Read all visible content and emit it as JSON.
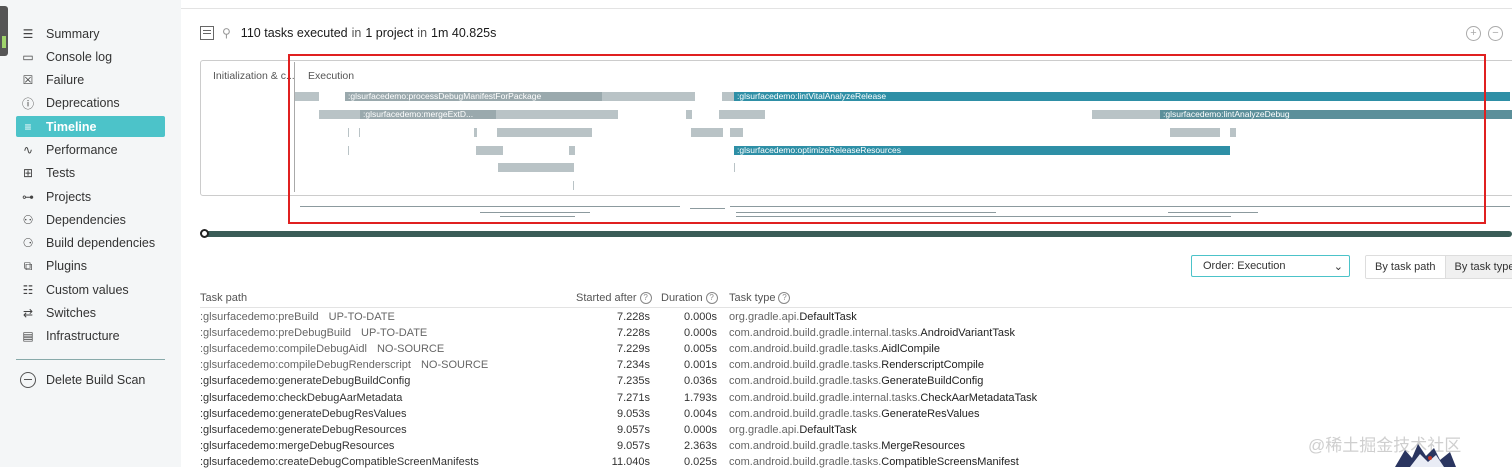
{
  "sidebar": {
    "items": [
      {
        "label": "Summary",
        "icon": "summary-icon",
        "glyph": "☰"
      },
      {
        "label": "Console log",
        "icon": "console-icon",
        "glyph": "▭"
      },
      {
        "label": "Failure",
        "icon": "failure-icon",
        "glyph": "☒"
      },
      {
        "label": "Deprecations",
        "icon": "deprecations-icon",
        "glyph": "ⓘ"
      },
      {
        "label": "Timeline",
        "icon": "timeline-icon",
        "glyph": "≡",
        "active": true
      },
      {
        "label": "Performance",
        "icon": "performance-icon",
        "glyph": "∿"
      },
      {
        "label": "Tests",
        "icon": "tests-icon",
        "glyph": "⊞"
      },
      {
        "label": "Projects",
        "icon": "projects-icon",
        "glyph": "⊶"
      },
      {
        "label": "Dependencies",
        "icon": "dependencies-icon",
        "glyph": "⚇"
      },
      {
        "label": "Build dependencies",
        "icon": "build-dependencies-icon",
        "glyph": "⚆"
      },
      {
        "label": "Plugins",
        "icon": "plugins-icon",
        "glyph": "⧉"
      },
      {
        "label": "Custom values",
        "icon": "custom-values-icon",
        "glyph": "☷"
      },
      {
        "label": "Switches",
        "icon": "switches-icon",
        "glyph": "⇄"
      },
      {
        "label": "Infrastructure",
        "icon": "infrastructure-icon",
        "glyph": "▤"
      }
    ],
    "delete_label": "Delete Build Scan"
  },
  "summary": {
    "count": "110",
    "text1": "tasks executed",
    "in1": "in",
    "projects": "1 project",
    "in2": "in",
    "duration": "1m 40.825s"
  },
  "timeline": {
    "init_label": "Initialization & c...",
    "exec_label": "Execution",
    "bar_labels": [
      ":glsurfacedemo:processDebugManifestForPackage",
      ":glsurfacedemo:lintVitalAnalyzeRelease",
      ":glsurfacedemo:mergeExtD...",
      ":glsurfacedemo:lintAnalyzeDebug",
      ":glsurfacedemo:optimizeReleaseResources"
    ]
  },
  "controls": {
    "order_label": "Order: Execution",
    "by_task_path": "By task path",
    "by_task_type": "By task type"
  },
  "table": {
    "headers": {
      "path": "Task path",
      "started": "Started after",
      "duration": "Duration",
      "type": "Task type"
    },
    "rows": [
      {
        "path": ":glsurfacedemo:preBuild",
        "outcome": "UP-TO-DATE",
        "started": "7.228s",
        "duration": "0.000s",
        "type_pkg": "org.gradle.api.",
        "type_cls": "DefaultTask"
      },
      {
        "path": ":glsurfacedemo:preDebugBuild",
        "outcome": "UP-TO-DATE",
        "started": "7.228s",
        "duration": "0.000s",
        "type_pkg": "com.android.build.gradle.internal.tasks.",
        "type_cls": "AndroidVariantTask"
      },
      {
        "path": ":glsurfacedemo:compileDebugAidl",
        "outcome": "NO-SOURCE",
        "started": "7.229s",
        "duration": "0.005s",
        "type_pkg": "com.android.build.gradle.tasks.",
        "type_cls": "AidlCompile"
      },
      {
        "path": ":glsurfacedemo:compileDebugRenderscript",
        "outcome": "NO-SOURCE",
        "started": "7.234s",
        "duration": "0.001s",
        "type_pkg": "com.android.build.gradle.tasks.",
        "type_cls": "RenderscriptCompile"
      },
      {
        "path": ":glsurfacedemo:generateDebugBuildConfig",
        "outcome": "",
        "started": "7.235s",
        "duration": "0.036s",
        "type_pkg": "com.android.build.gradle.tasks.",
        "type_cls": "GenerateBuildConfig"
      },
      {
        "path": ":glsurfacedemo:checkDebugAarMetadata",
        "outcome": "",
        "started": "7.271s",
        "duration": "1.793s",
        "type_pkg": "com.android.build.gradle.internal.tasks.",
        "type_cls": "CheckAarMetadataTask"
      },
      {
        "path": ":glsurfacedemo:generateDebugResValues",
        "outcome": "",
        "started": "9.053s",
        "duration": "0.004s",
        "type_pkg": "com.android.build.gradle.tasks.",
        "type_cls": "GenerateResValues"
      },
      {
        "path": ":glsurfacedemo:generateDebugResources",
        "outcome": "",
        "started": "9.057s",
        "duration": "0.000s",
        "type_pkg": "org.gradle.api.",
        "type_cls": "DefaultTask"
      },
      {
        "path": ":glsurfacedemo:mergeDebugResources",
        "outcome": "",
        "started": "9.057s",
        "duration": "2.363s",
        "type_pkg": "com.android.build.gradle.tasks.",
        "type_cls": "MergeResources"
      },
      {
        "path": ":glsurfacedemo:createDebugCompatibleScreenManifests",
        "outcome": "",
        "started": "11.040s",
        "duration": "0.025s",
        "type_pkg": "com.android.build.gradle.tasks.",
        "type_cls": "CompatibleScreensManifest"
      }
    ]
  },
  "watermark": "@稀土掘金技术社区",
  "colors": {
    "accent": "#4cc3c9",
    "bar_teal": "#2e8fa6",
    "bar_gray": "#b9c3c6",
    "highlight_frame": "#e02020"
  }
}
